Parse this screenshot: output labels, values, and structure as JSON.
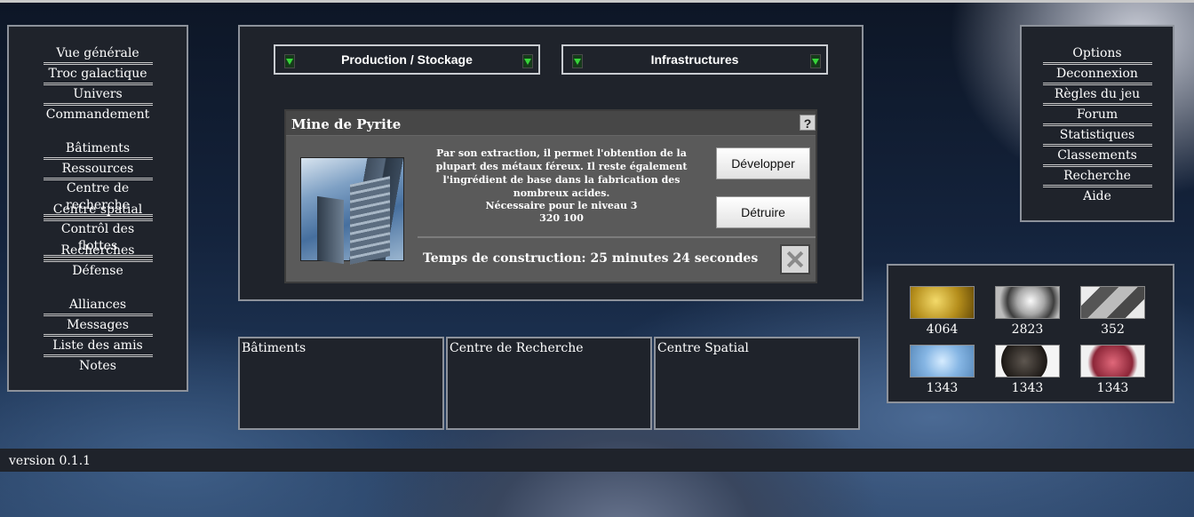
{
  "left_nav": {
    "group1": [
      "Vue générale",
      "Troc galactique",
      "Univers",
      "Commandement"
    ],
    "group2": [
      "Bâtiments",
      "Ressources",
      "Centre de recherche",
      "Centre spatial",
      "Contrôl des flottes",
      "Recherches",
      "Défense"
    ],
    "group3": [
      "Alliances",
      "Messages",
      "Liste des amis",
      "Notes"
    ]
  },
  "right_nav": [
    "Options",
    "Deconnexion",
    "Règles du jeu",
    "Forum",
    "Statistiques",
    "Classements",
    "Recherche",
    "Aide"
  ],
  "dropdowns": {
    "left": "Production / Stockage",
    "right": "Infrastructures"
  },
  "building": {
    "title": "Mine de Pyrite",
    "help": "?",
    "description": "Par son extraction, il permet l'obtention de la plupart des métaux féreux. Il reste également l'ingrédient de base dans la fabrication des nombreux acides.",
    "requirement_label": "Nécessaire pour le niveau 3",
    "requirement_value": "320 100",
    "develop_label": "Développer",
    "destroy_label": "Détruire",
    "construction_time": "Temps de construction: 25 minutes 24 secondes"
  },
  "queues": [
    "Bâtiments",
    "Centre de Recherche",
    "Centre Spatial"
  ],
  "resources": [
    "4064",
    "2823",
    "352",
    "1343",
    "1343",
    "1343"
  ],
  "version": "version 0.1.1"
}
